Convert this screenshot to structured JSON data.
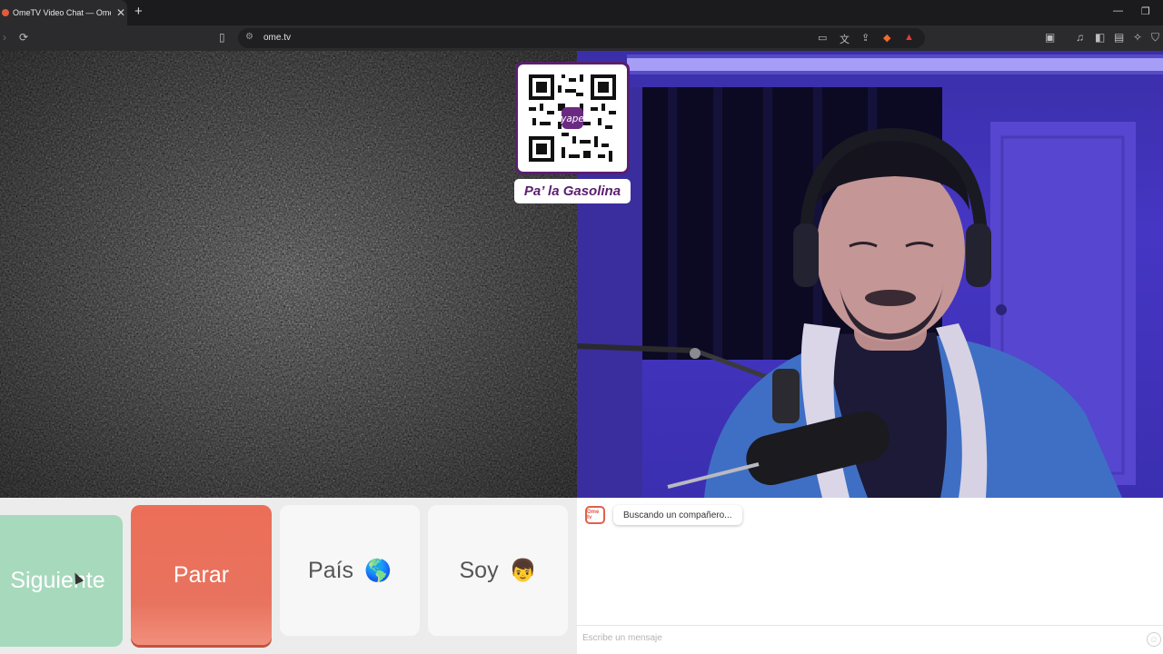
{
  "browser": {
    "tab_title": "OmeTV Video Chat — Omeg",
    "new_tab": "+",
    "url": "ome.tv",
    "window_minimize": "—",
    "window_restore": "❐"
  },
  "promo": {
    "caption": "Pa’ la Gasolina",
    "qr_brand": "yape"
  },
  "controls": {
    "next_label": "Siguiente",
    "stop_label": "Parar",
    "country_label": "País",
    "country_emoji": "🌎",
    "gender_label": "Soy",
    "gender_emoji": "👦"
  },
  "chat": {
    "logo_text": "Ome tv",
    "status_message": "Buscando un compañero...",
    "input_placeholder": "Escribe un mensaje"
  },
  "colors": {
    "next": "#a7d9bd",
    "stop": "#ec6e58",
    "qr_frame": "#5a1e6e"
  }
}
